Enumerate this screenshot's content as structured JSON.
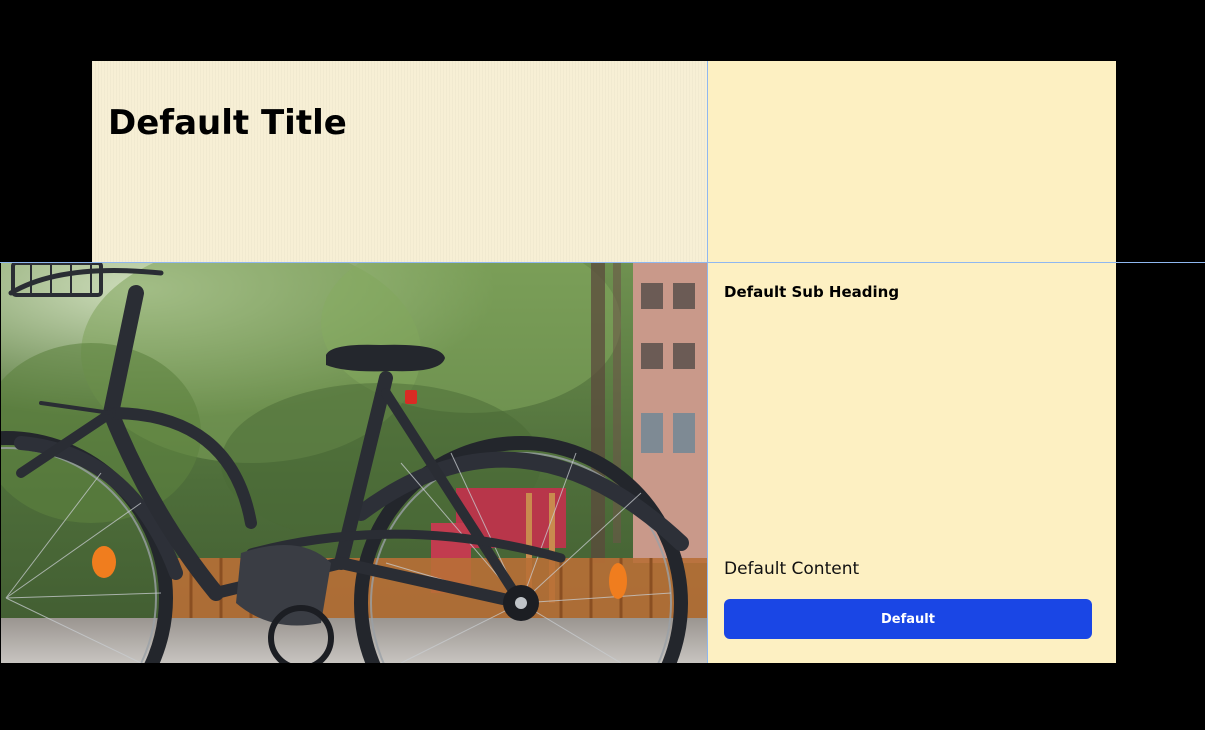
{
  "hero": {
    "title": "Default Title",
    "subheading": "Default Sub Heading",
    "content": "Default Content",
    "button_label": "Default"
  },
  "image": {
    "subject": "black city bicycle parked in a park"
  },
  "colors": {
    "page_background": "#000000",
    "title_panel": "#f7efd5",
    "content_panel": "#fdf0c2",
    "button": "#1a46e5",
    "button_text": "#ffffff",
    "guide_lines": "#8fb7f0"
  }
}
